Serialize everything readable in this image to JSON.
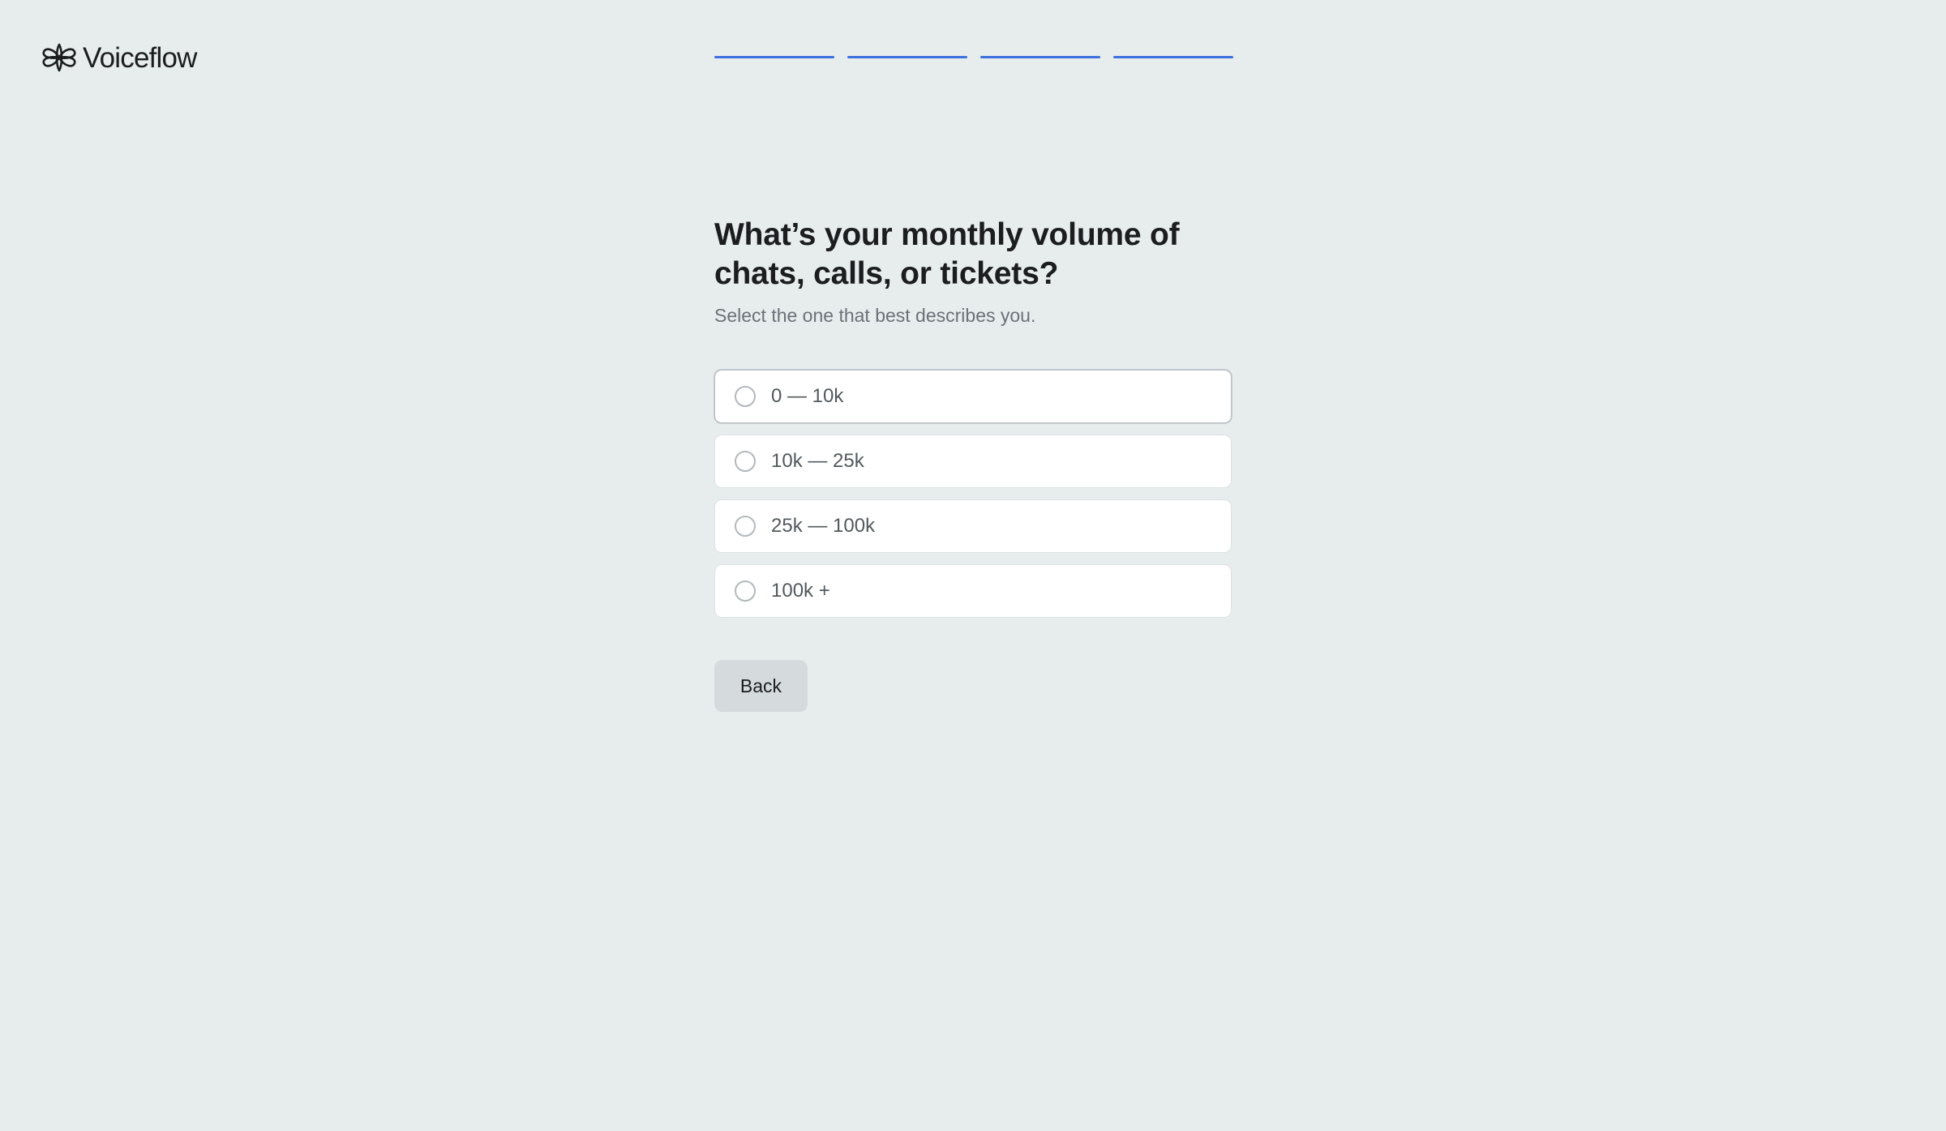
{
  "brand": {
    "name": "Voiceflow",
    "logo_icon": "voiceflow-logo-icon"
  },
  "progress": {
    "total_steps": 4,
    "completed_steps": 4,
    "color": "#3d71e0"
  },
  "question": {
    "title": "What’s your monthly volume of chats, calls, or tickets?",
    "subtitle": "Select the one that best describes you."
  },
  "options": [
    {
      "label": "0 — 10k",
      "selected": false
    },
    {
      "label": "10k — 25k",
      "selected": false
    },
    {
      "label": "25k — 100k",
      "selected": false
    },
    {
      "label": "100k +",
      "selected": false
    }
  ],
  "actions": {
    "back_label": "Back"
  },
  "colors": {
    "background": "#e7eced",
    "accent": "#3d71e0",
    "text_primary": "#1b1d1f",
    "text_secondary": "#6b7177"
  }
}
